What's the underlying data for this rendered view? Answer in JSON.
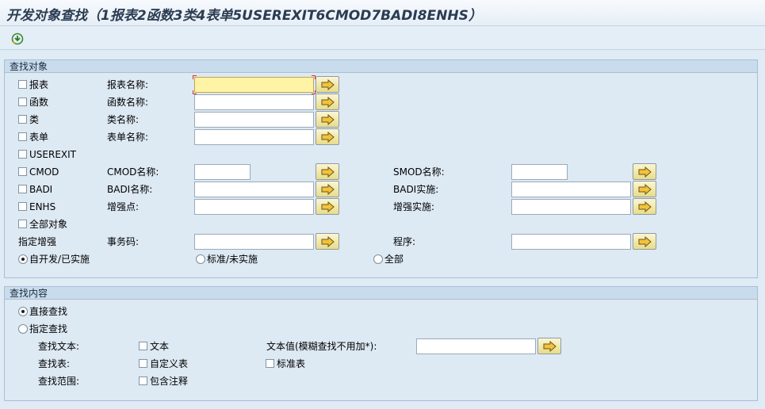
{
  "title": "开发对象查找（1报表2函数3类4表单5USEREXIT6CMOD7BADI8ENHS）",
  "toolbar": {
    "execute_icon": "execute-icon"
  },
  "group1": {
    "title": "查找对象",
    "types": [
      {
        "label": "报表",
        "checked": false
      },
      {
        "label": "函数",
        "checked": false
      },
      {
        "label": "类",
        "checked": false
      },
      {
        "label": "表单",
        "checked": false
      },
      {
        "label": "USEREXIT",
        "checked": false
      },
      {
        "label": "CMOD",
        "checked": false
      },
      {
        "label": "BADI",
        "checked": false
      },
      {
        "label": "ENHS",
        "checked": false
      },
      {
        "label": "全部对象",
        "checked": false
      }
    ],
    "specify_label": "指定增强",
    "fields": {
      "report_name": {
        "label": "报表名称:",
        "value": ""
      },
      "function_name": {
        "label": "函数名称:",
        "value": ""
      },
      "class_name": {
        "label": "类名称:",
        "value": ""
      },
      "form_name": {
        "label": "表单名称:",
        "value": ""
      },
      "cmod_name": {
        "label": "CMOD名称:",
        "value": ""
      },
      "badi_name": {
        "label": "BADI名称:",
        "value": ""
      },
      "enh_point": {
        "label": "增强点:",
        "value": ""
      },
      "tcode": {
        "label": "事务码:",
        "value": ""
      },
      "smod_name": {
        "label": "SMOD名称:",
        "value": ""
      },
      "badi_impl": {
        "label": "BADI实施:",
        "value": ""
      },
      "enh_impl": {
        "label": "增强实施:",
        "value": ""
      },
      "program": {
        "label": "程序:",
        "value": ""
      }
    },
    "radios": [
      {
        "label": "自开发/已实施",
        "selected": true
      },
      {
        "label": "标准/未实施",
        "selected": false
      },
      {
        "label": "全部",
        "selected": false
      }
    ]
  },
  "group2": {
    "title": "查找内容",
    "radios": [
      {
        "label": "直接查找",
        "selected": true
      },
      {
        "label": "指定查找",
        "selected": false
      }
    ],
    "find_text_label": "查找文本:",
    "text_checkbox": "文本",
    "text_value_label": "文本值(模糊查找不用加*):",
    "text_value": "",
    "find_table_label": "查找表:",
    "custom_table_checkbox": "自定义表",
    "standard_table_checkbox": "标准表",
    "find_scope_label": "查找范围:",
    "include_comments_checkbox": "包含注释"
  }
}
